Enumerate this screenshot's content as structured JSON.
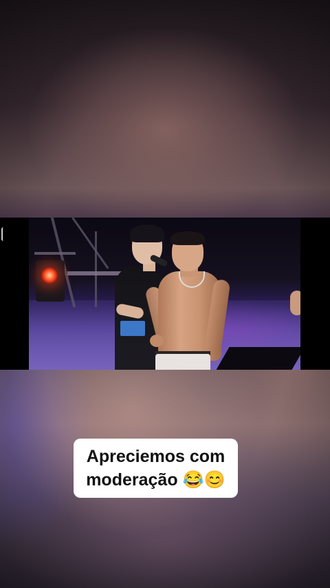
{
  "caption": {
    "line1": "Apreciemos com",
    "line2": "moderação 😂😊"
  },
  "colors": {
    "caption_background": "#ffffff",
    "caption_text": "#111111",
    "letterbox": "#000000"
  }
}
